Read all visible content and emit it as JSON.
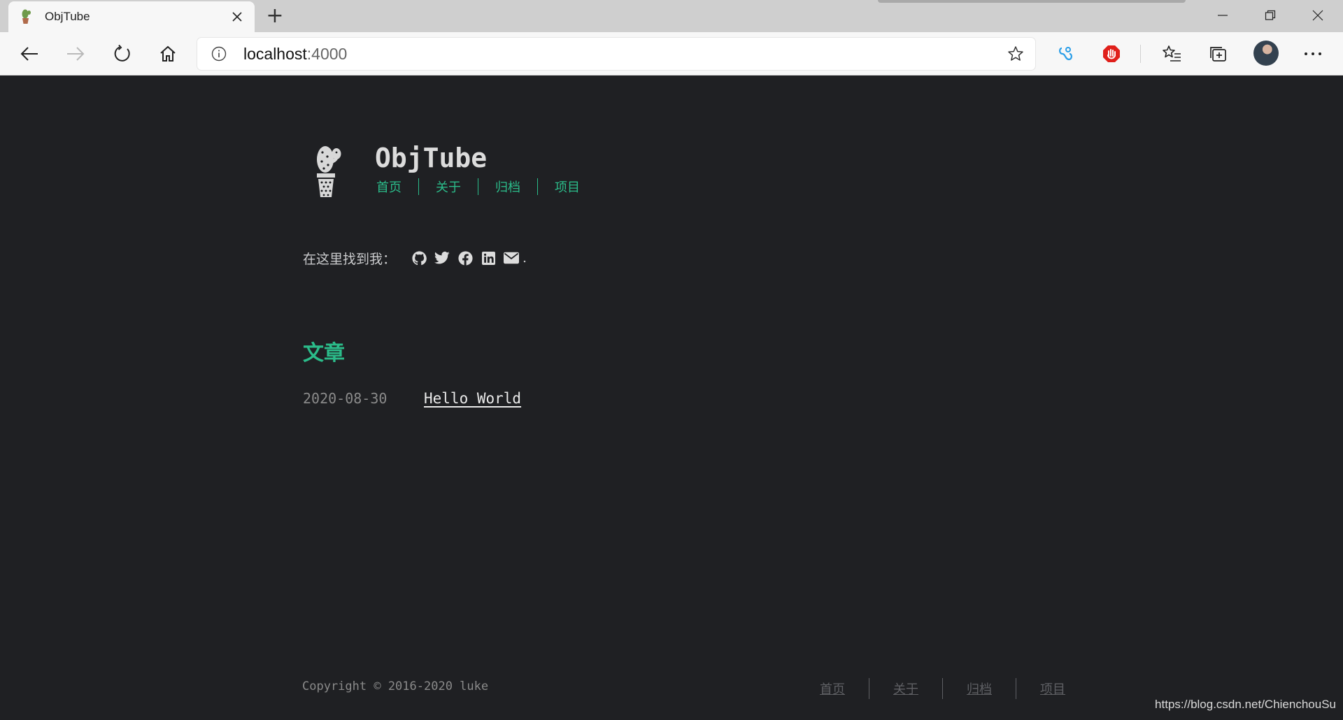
{
  "browser": {
    "tab_title": "ObjTube",
    "new_tab_symbol": "+",
    "address_host": "localhost",
    "address_port": ":4000",
    "icons": [
      "cactus-favicon",
      "close-icon",
      "plus-icon",
      "minimize-icon",
      "restore-icon",
      "close-window-icon",
      "back-icon",
      "forward-icon",
      "refresh-icon",
      "home-icon",
      "info-icon",
      "star-icon",
      "translate-extension-icon",
      "adblock-icon",
      "favorites-icon",
      "collections-icon",
      "profile-avatar",
      "more-icon"
    ]
  },
  "site": {
    "title": "ObjTube",
    "nav": [
      "首页",
      "关于",
      "归档",
      "项目"
    ],
    "find_me_label": "在这里找到我：",
    "find_me_end": ".",
    "social_icons": [
      "github-icon",
      "twitter-icon",
      "facebook-icon",
      "linkedin-icon",
      "email-icon"
    ],
    "section_title": "文章",
    "posts": [
      {
        "date": "2020-08-30",
        "title": "Hello World"
      }
    ],
    "copyright": "Copyright © 2016-2020 luke",
    "footer_nav": [
      "首页",
      "关于",
      "归档",
      "项目"
    ]
  },
  "watermark": "https://blog.csdn.net/ChienchouSu",
  "colors": {
    "page_background": "#1f2023",
    "accent": "#2bbc8a",
    "text": "#c9cacc",
    "muted": "#8a8a8a"
  }
}
